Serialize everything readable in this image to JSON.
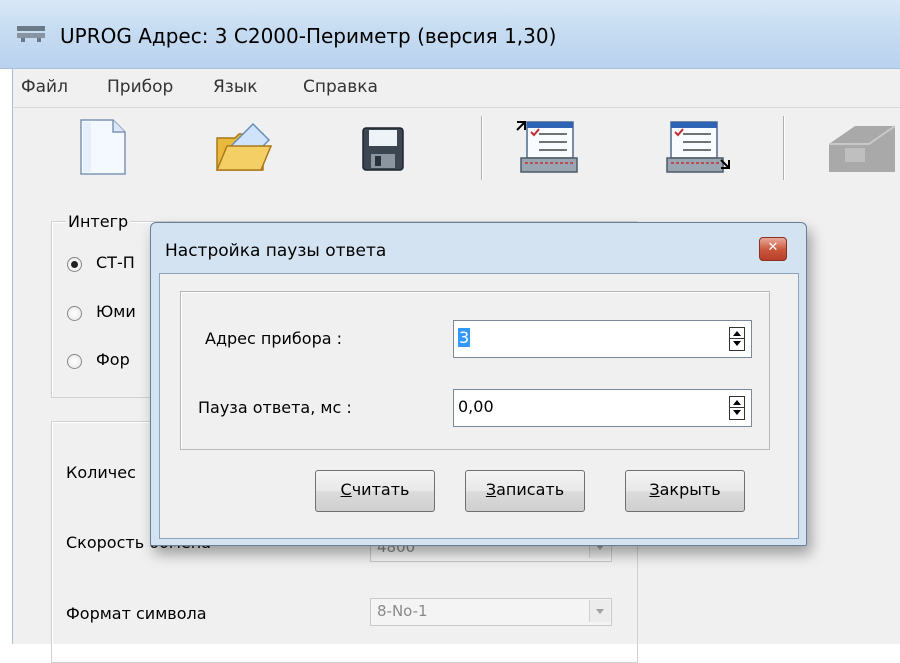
{
  "window": {
    "title": "UPROG  Адрес:  3  С2000-Периметр (версия  1,30)"
  },
  "menu": [
    "Файл",
    "Прибор",
    "Язык",
    "Справка"
  ],
  "toolbar": {
    "buttons": [
      {
        "name": "new-document-icon"
      },
      {
        "name": "open-folder-icon"
      },
      {
        "name": "save-floppy-icon"
      },
      {
        "name": "read-config-icon"
      },
      {
        "name": "write-config-icon"
      },
      {
        "name": "device-disabled-icon"
      }
    ]
  },
  "main": {
    "group_title": "Интегр",
    "radios": [
      {
        "label": "СТ-П",
        "checked": true
      },
      {
        "label": "Юми",
        "checked": false
      },
      {
        "label": "Фор",
        "checked": false
      }
    ],
    "fields": [
      {
        "label": "Количес",
        "value": ""
      },
      {
        "label": "Скорость обмена",
        "value": "4800"
      },
      {
        "label": "Формат символа",
        "value": "8-No-1"
      }
    ]
  },
  "dialog": {
    "title": "Настройка паузы ответа",
    "address_label": "Адрес прибора :",
    "address_value": "3",
    "pause_label": "Пауза ответа, мс :",
    "pause_value": "0,00",
    "buttons": {
      "read": {
        "accel": "С",
        "rest": "читать"
      },
      "write": {
        "accel": "З",
        "rest": "аписать"
      },
      "close": {
        "accel": "З",
        "rest": "акрыть"
      }
    }
  }
}
